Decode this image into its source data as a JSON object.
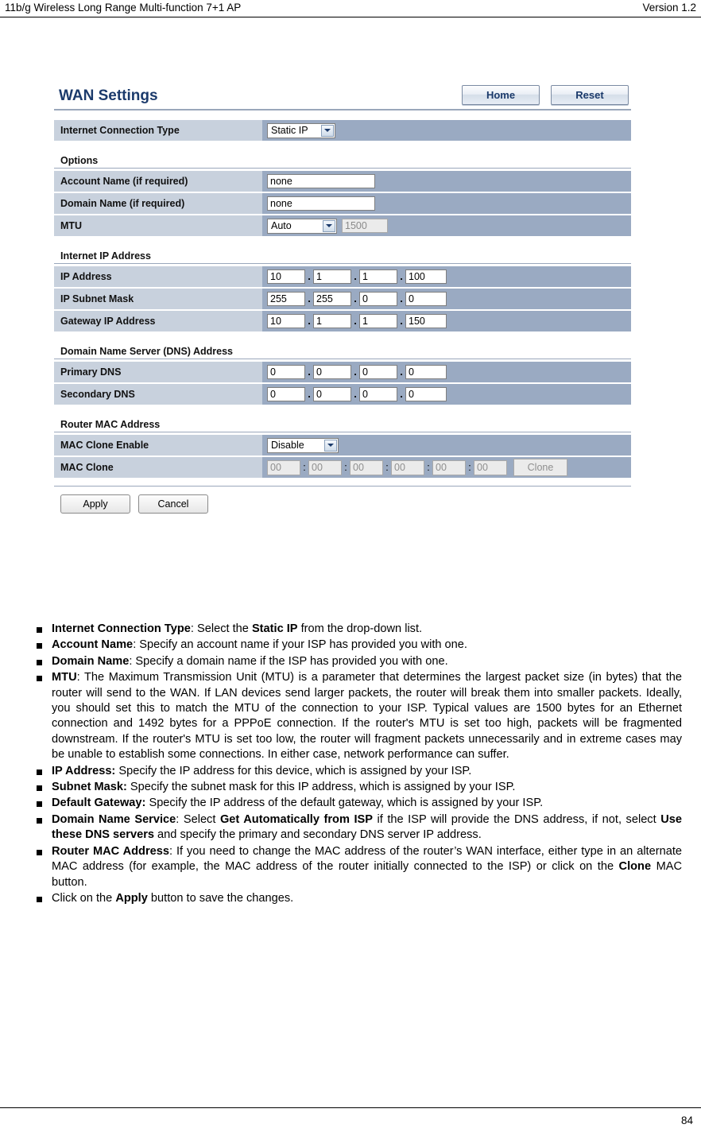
{
  "header": {
    "left": "11b/g Wireless Long Range Multi-function 7+1 AP",
    "right": "Version 1.2"
  },
  "panel": {
    "title": "WAN Settings",
    "buttons": {
      "home": "Home",
      "reset": "Reset"
    },
    "connection": {
      "label": "Internet Connection Type",
      "value": "Static IP"
    },
    "options": {
      "title": "Options",
      "account_label": "Account Name (if required)",
      "account_value": "none",
      "domain_label": "Domain Name (if required)",
      "domain_value": "none",
      "mtu_label": "MTU",
      "mtu_mode": "Auto",
      "mtu_value": "1500"
    },
    "internet_ip": {
      "title": "Internet IP Address",
      "ip_label": "IP Address",
      "ip": [
        "10",
        "1",
        "1",
        "100"
      ],
      "mask_label": "IP Subnet Mask",
      "mask": [
        "255",
        "255",
        "0",
        "0"
      ],
      "gw_label": "Gateway IP Address",
      "gw": [
        "10",
        "1",
        "1",
        "150"
      ]
    },
    "dns": {
      "title": "Domain Name Server (DNS) Address",
      "primary_label": "Primary DNS",
      "primary": [
        "0",
        "0",
        "0",
        "0"
      ],
      "secondary_label": "Secondary DNS",
      "secondary": [
        "0",
        "0",
        "0",
        "0"
      ]
    },
    "mac": {
      "title": "Router MAC Address",
      "enable_label": "MAC Clone Enable",
      "enable_value": "Disable",
      "clone_label": "MAC Clone",
      "octets": [
        "00",
        "00",
        "00",
        "00",
        "00",
        "00"
      ],
      "clone_button": "Clone"
    },
    "apply": "Apply",
    "cancel": "Cancel"
  },
  "bullets": [
    {
      "lead": "Internet Connection Type",
      "text_before": ": Select the ",
      "strong": "Static IP",
      "text_after": " from the drop-down list."
    },
    {
      "lead": "Account Name",
      "text_before": ": Specify an account name if your ISP has provided you with one.",
      "strong": "",
      "text_after": ""
    },
    {
      "lead": "Domain Name",
      "text_before": ": Specify a domain name if the ISP has provided you with one.",
      "strong": "",
      "text_after": ""
    },
    {
      "lead": "MTU",
      "text_before": ": The Maximum Transmission Unit (MTU) is a parameter that determines the largest packet size (in bytes) that the router will send to the WAN. If LAN devices send larger packets, the router will break them into smaller packets. Ideally, you should set this to match the MTU of the connection to your ISP. Typical values are 1500 bytes for an Ethernet connection and 1492 bytes for a PPPoE connection. If the router's MTU is set too high, packets will be fragmented downstream. If the router's MTU is set too low, the router will fragment packets unnecessarily and in extreme cases may be unable to establish some connections. In either case, network performance can suffer.",
      "strong": "",
      "text_after": ""
    },
    {
      "lead": "IP Address:",
      "text_before": " Specify the IP address for this device, which is assigned by your ISP.",
      "strong": "",
      "text_after": ""
    },
    {
      "lead": "Subnet Mask:",
      "text_before": " Specify the subnet mask for this IP address, which is assigned by your ISP.",
      "strong": "",
      "text_after": ""
    },
    {
      "lead": "Default Gateway:",
      "text_before": " Specify the IP address of the default gateway, which is assigned by your ISP.",
      "strong": "",
      "text_after": ""
    },
    {
      "lead": "Domain Name Service",
      "text_before": ": Select ",
      "strong": "Get Automatically from ISP",
      "text_after": " if the ISP will provide the DNS address, if not, select ",
      "strong2": "Use these DNS servers",
      "text_after2": " and specify the primary and secondary DNS server IP address."
    },
    {
      "lead": "Router MAC Address",
      "text_before": ": If you need to change the MAC address of the router’s WAN interface, either type in an alternate MAC address (for example, the MAC address of the router initially connected to the ISP) or click on the ",
      "strong": "Clone",
      "text_after": " MAC button."
    },
    {
      "lead": "",
      "text_before": "Click on the ",
      "strong": "Apply",
      "text_after": " button to save the changes."
    }
  ],
  "footer": {
    "page": "84"
  }
}
